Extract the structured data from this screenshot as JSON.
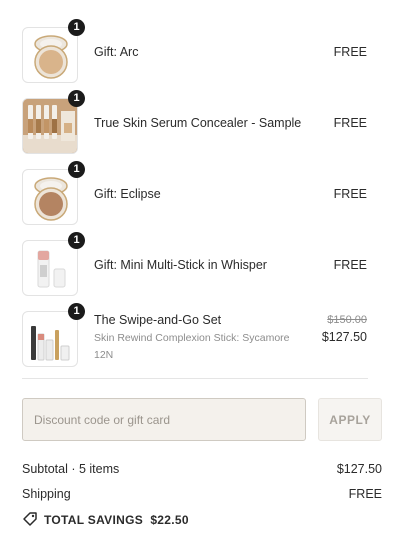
{
  "items": [
    {
      "name": "Gift: Arc",
      "quantity": "1",
      "price": "FREE",
      "icon": "compact-powder-gold-icon"
    },
    {
      "name": "True Skin Serum Concealer - Sample",
      "quantity": "1",
      "price": "FREE",
      "icon": "concealer-vials-icon"
    },
    {
      "name": "Gift: Eclipse",
      "quantity": "1",
      "price": "FREE",
      "icon": "compact-bronzer-icon"
    },
    {
      "name": "Gift: Mini Multi-Stick in Whisper",
      "quantity": "1",
      "price": "FREE",
      "icon": "multi-stick-icon"
    },
    {
      "name": "The Swipe-and-Go Set",
      "variant": "Skin Rewind Complexion Stick: Sycamore 12N",
      "quantity": "1",
      "original_price": "$150.00",
      "price": "$127.50",
      "icon": "makeup-set-icon"
    }
  ],
  "discount": {
    "placeholder": "Discount code or gift card",
    "apply_label": "APPLY"
  },
  "summary": {
    "subtotal_label": "Subtotal · 5 items",
    "subtotal_value": "$127.50",
    "shipping_label": "Shipping",
    "shipping_value": "FREE",
    "savings_label": "TOTAL SAVINGS",
    "savings_value": "$22.50"
  },
  "colors": {
    "badge": "#1b1b1b",
    "input_bg": "#f4f1ec",
    "muted": "#8d8d8d"
  }
}
